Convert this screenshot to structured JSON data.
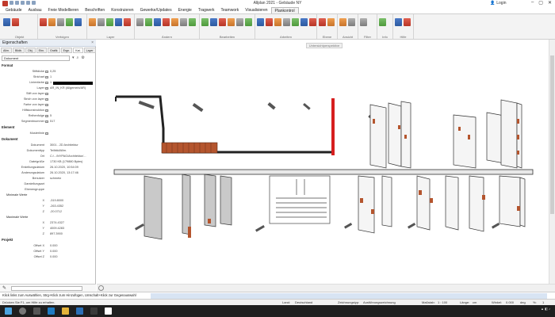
{
  "window": {
    "title": "Allplan 2021 - Gebäude NY",
    "login_label": "Login",
    "controls": [
      "–",
      "▢",
      "✕"
    ]
  },
  "menu_tabs": [
    "Gebäude",
    "Ausbau",
    "Freie Modellieren",
    "Beschriften",
    "Konstruieren",
    "Gewerke/Updates",
    "Energie",
    "Tragwerk",
    "Teamwork",
    "Visualisieren",
    "Plankontrol"
  ],
  "active_tab_index": 10,
  "ribbon": {
    "groups": [
      "Objekt",
      "Verfolgen",
      "Layer",
      "Ändern",
      "Bearbeiten",
      "Arbeiten",
      "Ebene",
      "Ansicht",
      "Filter",
      "Info",
      "Hilfe"
    ]
  },
  "panel": {
    "title": "Eigenschaften",
    "tabs": [
      "Allm.",
      "Bildb.",
      "Obj.",
      "Ebn.",
      "Grafik",
      "Ergn.",
      "Kat.",
      "Layer"
    ],
    "active_tab_index": 6,
    "selected_object": "Dokument",
    "sections": {
      "format": "Format",
      "element": "Element",
      "dokument": "Dokument",
      "projekt": "Projekt"
    },
    "format_rows": [
      {
        "label": "Stiftdicke",
        "value": "0,25"
      },
      {
        "label": "Strichart",
        "value": "1"
      },
      {
        "label": "Linienfarbe",
        "value": "1"
      },
      {
        "label": "Layer",
        "value": "AR_IN_KR (Allgemein/AR)"
      },
      {
        "label": "Stift von layer",
        "value": ""
      },
      {
        "label": "Strich von layer",
        "value": ""
      },
      {
        "label": "Farbe von layer",
        "value": ""
      },
      {
        "label": "Hilfskonstruktion",
        "value": ""
      },
      {
        "label": "Reihenfolge",
        "value": "5"
      },
      {
        "label": "Segmentnummer",
        "value": "517"
      }
    ],
    "element_rows": [
      {
        "label": "Musterlinie",
        "value": ""
      }
    ],
    "dokument_rows": [
      {
        "label": "Dokument",
        "value": "3001 - 2D Architektur"
      },
      {
        "label": "Dokumenttyp",
        "value": "Teilbild/Allm."
      },
      {
        "label": "Ort",
        "value": "C:/.../NYPAG/Architektur/..."
      },
      {
        "label": "Dateigröße",
        "value": "1730 KB (179880 Bytes)"
      },
      {
        "label": "Erstellungsdatum",
        "value": "26.10.2020, 10:54:09"
      },
      {
        "label": "Änderungsdatum",
        "value": "26.10.2020, 13:17:46"
      },
      {
        "label": "Benutzer",
        "value": "schmetz"
      },
      {
        "label": "Darstellungsart",
        "value": ""
      },
      {
        "label": "Ebenengruppe",
        "value": ""
      }
    ],
    "min_label": "Minimale Werte",
    "min_values": [
      {
        "axis": "X",
        "value": "-319.8000"
      },
      {
        "axis": "Y",
        "value": "-263.4352"
      },
      {
        "axis": "Z",
        "value": "-20.0712"
      }
    ],
    "max_label": "Maximale Werte",
    "max_values": [
      {
        "axis": "X",
        "value": "2374.4327"
      },
      {
        "axis": "Y",
        "value": "4009.4283"
      },
      {
        "axis": "Z",
        "value": "897.3900"
      }
    ],
    "projekt_rows": [
      {
        "label": "Offset X",
        "value": "0.000"
      },
      {
        "label": "Offset Y",
        "value": "0.000"
      },
      {
        "label": "Offset Z",
        "value": "0.000"
      }
    ]
  },
  "viewport": {
    "view_label": "Untersichtperspektive"
  },
  "hint": "Klick links zum Auswählen, Strg+Klick zum Hinzufügen, Umschalt+Klick zur Gegenauswahl",
  "status": {
    "left": "Drücken Sie F1, um Hilfe zu erhalten.",
    "land_label": "Land:",
    "land_value": "Deutschland",
    "drawing_type_label": "Zeichnungstyp:",
    "drawing_type_value": "Ausführungszeichnung",
    "scale_label": "Maßstab:",
    "scale_value": "1 : 100",
    "length_label": "Länge:",
    "length_value": "cm",
    "angle_label": "Winkel:",
    "angle_value": "0.000",
    "deg_label": "deg",
    "percent_label": "%:",
    "percent_value": "1"
  },
  "colors": {
    "accent_red": "#d61f1f",
    "brick": "#b4552e",
    "taskbar": "#1f1f1f"
  }
}
